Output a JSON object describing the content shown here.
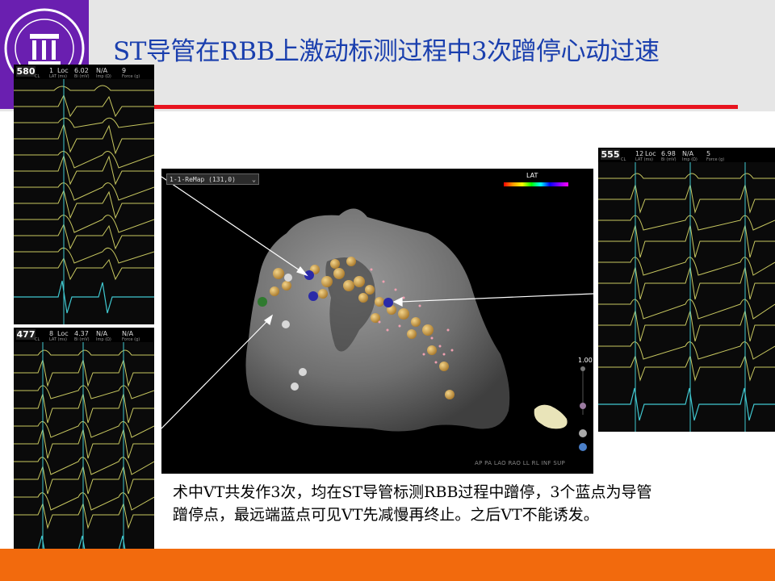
{
  "title": "ST导管在RBB上激动标测过程中3次蹭停心动过速",
  "caption": {
    "line1": "术中VT共发作3次，均在ST导管标测RBB过程中蹭停，3个蓝点为导管",
    "line2": "蹭停点，最远端蓝点可见VT先减慢再终止。之后VT不能诱发。"
  },
  "map": {
    "dropdown_value": "1-1-ReMap (131,0)",
    "legend_label": "LAT",
    "scale_value": "1.00",
    "view_buttons": [
      "AP",
      "PA",
      "LAO",
      "RAO",
      "LL",
      "RL",
      "INF",
      "SUP"
    ]
  },
  "ecg_panels": [
    {
      "cl": "580",
      "loc": "1",
      "lat": "6.02",
      "bi": "N/A",
      "force": "9",
      "labels": {
        "cl": "CL",
        "lat": "LAT (ms)",
        "bi": "Bi (mV)",
        "imp": "Imp (Ω)",
        "force": "Force (g)"
      }
    },
    {
      "cl": "477",
      "loc": "8",
      "lat": "4.37",
      "bi": "N/A",
      "force": "N/A",
      "labels": {
        "cl": "CL",
        "lat": "LAT (ms)",
        "bi": "Bi (mV)",
        "imp": "Imp (Ω)",
        "force": "Force (g)"
      }
    },
    {
      "cl": "555",
      "loc": "12",
      "lat": "6.98",
      "bi": "N/A",
      "force": "5",
      "labels": {
        "cl": "CL",
        "lat": "LAT (ms)",
        "bi": "Bi (mV)",
        "imp": "Imp (Ω)",
        "force": "Force (g)"
      }
    }
  ],
  "colors": {
    "title": "#1a3fae",
    "logo_bg": "#6a1fb0",
    "red_rule": "#e8141e",
    "bottom_bar": "#f26a0d",
    "ecg_trace": "#c8c860",
    "ecg_cyan": "#40c8d0"
  }
}
